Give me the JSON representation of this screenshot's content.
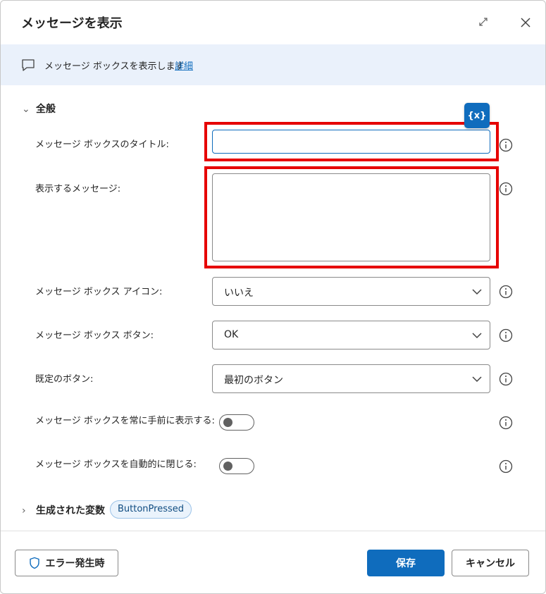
{
  "dialog": {
    "title": "メッセージを表示",
    "description": "メッセージ ボックスを表示します",
    "details_link": "詳細"
  },
  "general": {
    "section_label": "全般",
    "variable_button_label": "{x}",
    "fields": {
      "title": {
        "label": "メッセージ ボックスのタイトル:",
        "value": ""
      },
      "message": {
        "label": "表示するメッセージ:",
        "value": ""
      },
      "icon": {
        "label": "メッセージ ボックス アイコン:",
        "value": "いいえ"
      },
      "buttons": {
        "label": "メッセージ ボックス ボタン:",
        "value": "OK"
      },
      "default_button": {
        "label": "既定のボタン:",
        "value": "最初のボタン"
      },
      "always_on_top": {
        "label": "メッセージ ボックスを常に手前に表示する:",
        "enabled": false
      },
      "auto_close": {
        "label": "メッセージ ボックスを自動的に閉じる:",
        "enabled": false
      }
    }
  },
  "variables": {
    "section_label": "生成された変数",
    "chips": [
      "ButtonPressed"
    ]
  },
  "footer": {
    "on_error_label": "エラー発生時",
    "save_label": "保存",
    "cancel_label": "キャンセル"
  },
  "colors": {
    "accent": "#0f6cbd",
    "highlight": "#e60000",
    "banner": "#eaf1fb"
  },
  "icons": {
    "expand": "expand-icon",
    "close": "close-icon",
    "banner": "chat-bubble-icon",
    "info": "info-icon",
    "dropdown": "chevron-down-icon",
    "error": "shield-icon"
  }
}
